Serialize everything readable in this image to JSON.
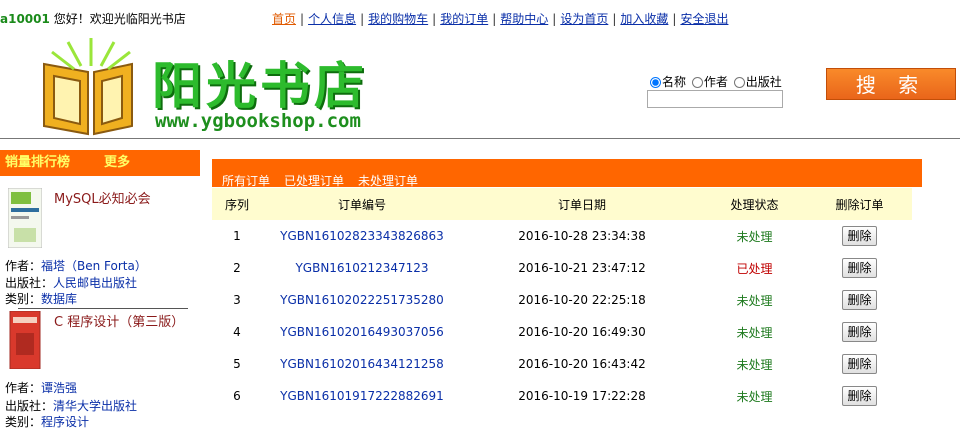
{
  "header": {
    "username": "a10001",
    "welcome": "您好！欢迎光临阳光书店",
    "nav": [
      {
        "label": "首页"
      },
      {
        "label": "个人信息"
      },
      {
        "label": "我的购物车"
      },
      {
        "label": "我的订单"
      },
      {
        "label": "帮助中心"
      },
      {
        "label": "设为首页"
      },
      {
        "label": "加入收藏"
      },
      {
        "label": "安全退出"
      }
    ]
  },
  "logo": {
    "text": "阳光书店",
    "url": "www.ygbookshop.com"
  },
  "search": {
    "options": [
      "名称",
      "作者",
      "出版社"
    ],
    "selected": "名称",
    "button_label": "搜 索",
    "input_value": ""
  },
  "sidebar": {
    "title": "销量排行榜",
    "more": "更多",
    "books": [
      {
        "title": "MySQL必知必会",
        "author_label": "作者：",
        "author": "福塔（Ben Forta）",
        "publisher_label": "出版社：",
        "publisher": "人民邮电出版社",
        "category_label": "类别：",
        "category": "数据库"
      },
      {
        "title": "C 程序设计（第三版）",
        "author_label": "作者：",
        "author": "谭浩强",
        "publisher_label": "出版社：",
        "publisher": "清华大学出版社",
        "category_label": "类别：",
        "category": "程序设计"
      }
    ]
  },
  "orders": {
    "tabs": [
      "所有订单",
      "已处理订单",
      "未处理订单"
    ],
    "columns": [
      "序列",
      "订单编号",
      "订单日期",
      "处理状态",
      "删除订单"
    ],
    "rows": [
      {
        "seq": "1",
        "id": "YGBN16102823343826863",
        "date": "2016-10-28 23:34:38",
        "status": "未处理",
        "action": "删除"
      },
      {
        "seq": "2",
        "id": "YGBN1610212347123",
        "date": "2016-10-21 23:47:12",
        "status": "已处理",
        "action": "删除"
      },
      {
        "seq": "3",
        "id": "YGBN16102022251735280",
        "date": "2016-10-20 22:25:18",
        "status": "未处理",
        "action": "删除"
      },
      {
        "seq": "4",
        "id": "YGBN16102016493037056",
        "date": "2016-10-20 16:49:30",
        "status": "未处理",
        "action": "删除"
      },
      {
        "seq": "5",
        "id": "YGBN16102016434121258",
        "date": "2016-10-20 16:43:42",
        "status": "未处理",
        "action": "删除"
      },
      {
        "seq": "6",
        "id": "YGBN16101917222882691",
        "date": "2016-10-19 17:22:28",
        "status": "未处理",
        "action": "删除"
      }
    ]
  },
  "colors": {
    "accent_orange": "#ff6600",
    "logo_green": "#2dbb2d",
    "link_blue": "#0a2fa8",
    "pending_green": "#1e7a1e",
    "done_red": "#c00000"
  }
}
